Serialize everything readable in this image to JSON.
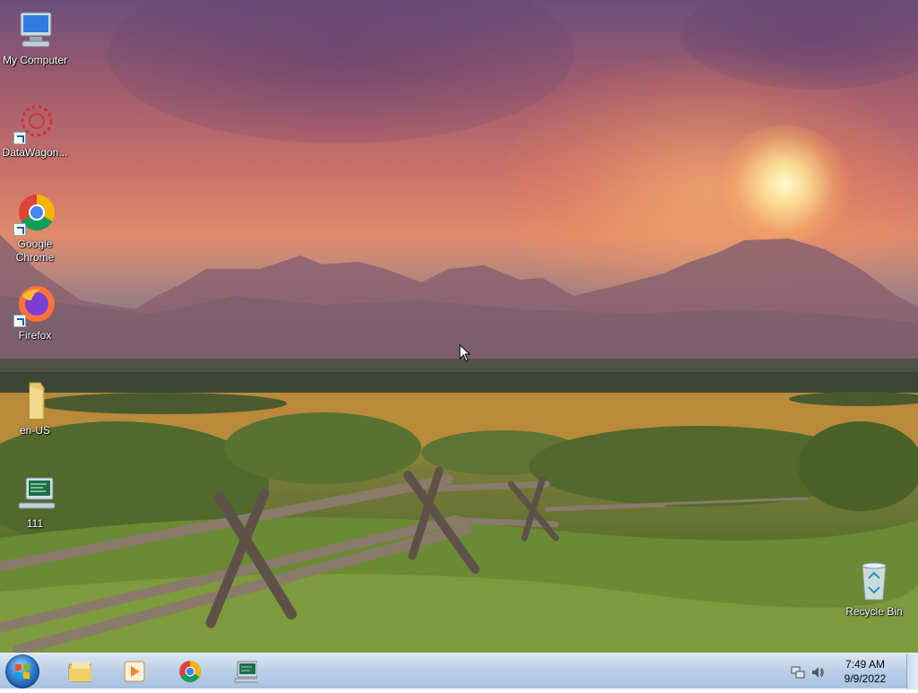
{
  "desktop": {
    "icons": [
      {
        "label": "My Computer",
        "icon": "computer-icon"
      },
      {
        "label": "DataWagon...",
        "icon": "datawagon-icon"
      },
      {
        "label": "Google Chrome",
        "icon": "chrome-icon"
      },
      {
        "label": "Firefox",
        "icon": "firefox-icon"
      },
      {
        "label": "en-US",
        "icon": "folder-icon"
      },
      {
        "label": "111",
        "icon": "computer-monitor-icon"
      },
      {
        "label": "Recycle Bin",
        "icon": "recycle-bin-icon"
      }
    ]
  },
  "taskbar": {
    "start": {
      "icon": "windows-start-icon"
    },
    "pinned": [
      {
        "icon": "file-explorer-icon"
      },
      {
        "icon": "media-player-icon"
      },
      {
        "icon": "chrome-icon"
      },
      {
        "icon": "computer-monitor-icon"
      }
    ],
    "tray": {
      "network_icon": "network-icon",
      "volume_icon": "volume-icon",
      "time": "7:49 AM",
      "date": "9/9/2022"
    }
  },
  "colors": {
    "taskbar_top": "#dbe7f3",
    "taskbar_bottom": "#a8c2df",
    "sky_purple": "#6a4f7a",
    "sunset_orange": "#e08a6a"
  }
}
